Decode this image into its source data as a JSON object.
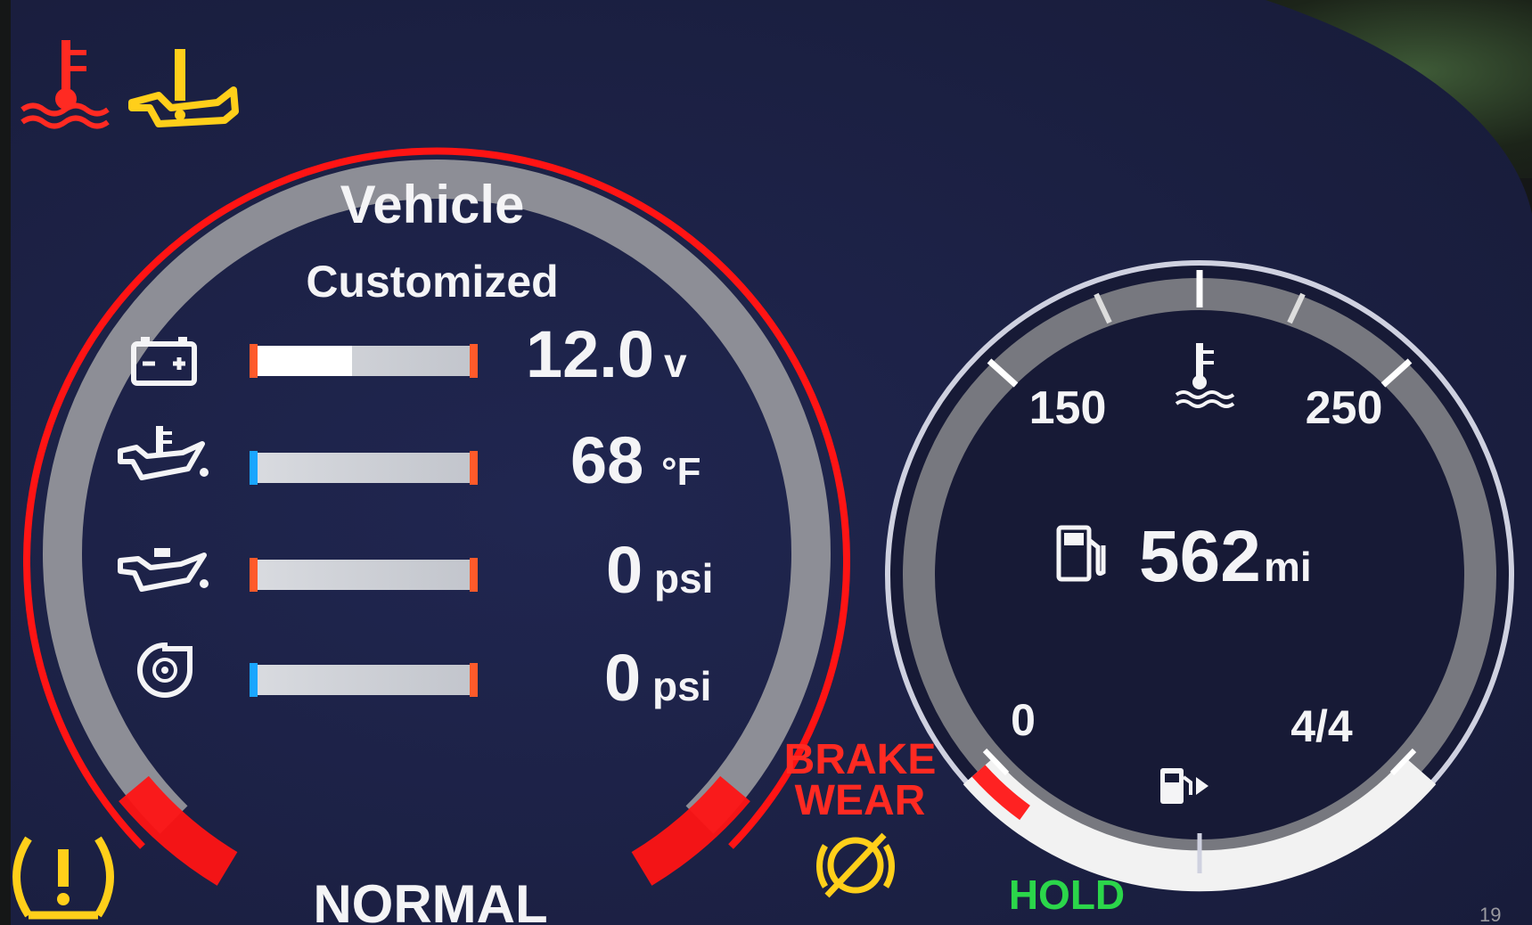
{
  "warning_lights": {
    "coolant_temp": "coolant-temperature-warning-icon",
    "oil_level": "oil-level-warning-icon",
    "tire_pressure": "tire-pressure-warning-icon",
    "brake_wear_text_line1": "BRAKE",
    "brake_wear_text_line2": "WEAR",
    "parking_brake_auto": "auto-parking-brake-icon",
    "hold_label": "HOLD",
    "drive_mode": "NORMAL"
  },
  "vehicle_panel": {
    "title": "Vehicle",
    "subtitle": "Customized",
    "gauges": [
      {
        "icon": "battery-icon",
        "value": "12.0",
        "unit": "v",
        "fill": 0.45,
        "start_color": "#ff5a2a"
      },
      {
        "icon": "oil-temperature-icon",
        "value": "68",
        "unit": "°F",
        "fill": 0.0,
        "start_color": "#1aa6ff"
      },
      {
        "icon": "oil-pressure-icon",
        "value": "0",
        "unit": "psi",
        "fill": 0.0,
        "start_color": "#ff5a2a"
      },
      {
        "icon": "turbo-boost-icon",
        "value": "0",
        "unit": "psi",
        "fill": 0.0,
        "start_color": "#1aa6ff"
      }
    ]
  },
  "right_gauge": {
    "temp_label_low": "150",
    "temp_label_high": "250",
    "fuel_label_empty": "0",
    "fuel_label_full": "4/4",
    "range_value": "562",
    "range_unit": "mi",
    "fuel_level": 1.0
  },
  "page_number": "19",
  "colors": {
    "warning_red": "#ff2a22",
    "warning_amber": "#ffcf1a",
    "hold_green": "#2bd64a",
    "panel_navy": "#1c2145"
  }
}
